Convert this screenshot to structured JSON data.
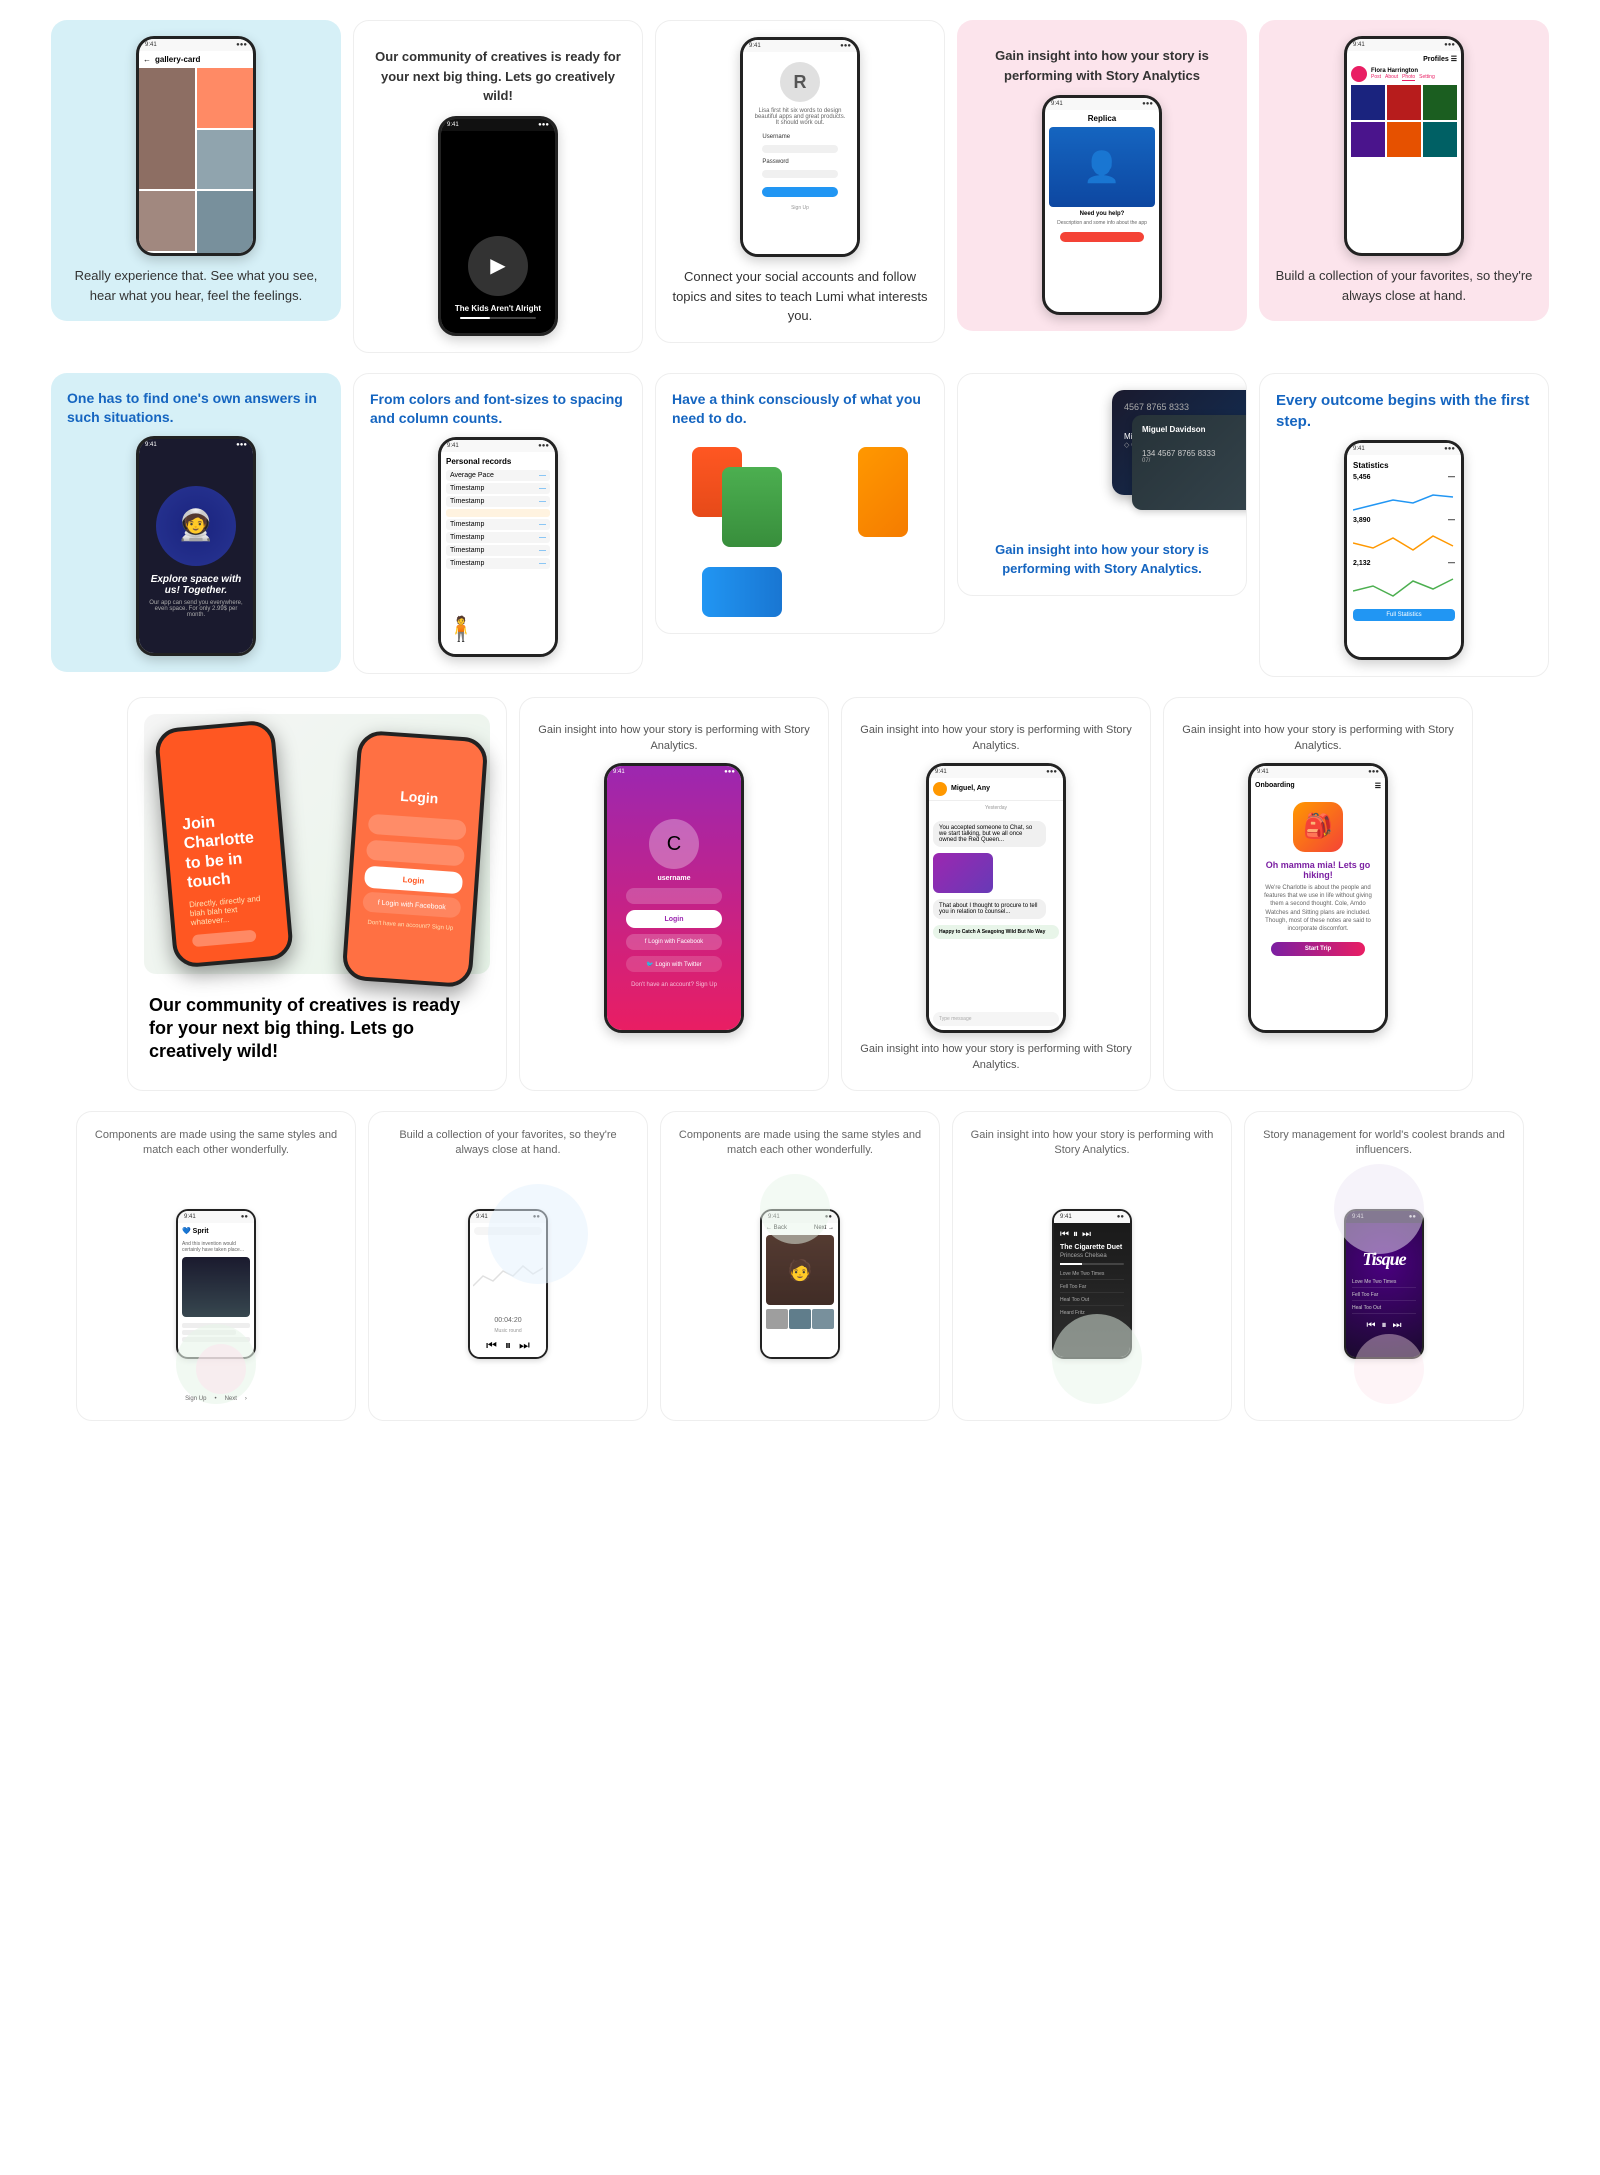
{
  "rows": [
    {
      "id": "row1",
      "cards": [
        {
          "id": "gallery-card",
          "bg": "light-blue",
          "text": "Really experience that. See what you see, hear what you hear, feel the feelings.",
          "type": "gallery-phone"
        },
        {
          "id": "creatives-card",
          "bg": "white",
          "text": "Our community of creatives is ready for your next big thing. Lets go creatively wild!",
          "type": "dark-phone"
        },
        {
          "id": "connect-card",
          "bg": "white",
          "text": "Connect your social accounts and follow topics and sites to teach Lumi what interests you.",
          "type": "r-phone"
        },
        {
          "id": "analytics-card",
          "bg": "pink",
          "text": "Gain insight into how your story is performing with Story Analytics",
          "type": "analytics-phone"
        },
        {
          "id": "favorites-card",
          "bg": "pink",
          "text": "Build a collection of your favorites, so they're always close at hand.",
          "type": "profiles-phone"
        }
      ]
    },
    {
      "id": "row2",
      "cards": [
        {
          "id": "find-answers",
          "bg": "light-blue",
          "text": "One has to find one's own answers in such situations.",
          "type": "spaceman"
        },
        {
          "id": "colors-fonts",
          "bg": "white",
          "text": "From colors and font-sizes to spacing and column counts.",
          "type": "personal-records"
        },
        {
          "id": "think-consciously",
          "bg": "white",
          "text": "Have a think consciously of what you need to do.",
          "type": "colorful-illustration"
        },
        {
          "id": "credit-card-section",
          "bg": "white",
          "text": "Gain insight into how your story is performing with Story Analytics.",
          "type": "credit-cards"
        },
        {
          "id": "first-step",
          "bg": "white",
          "text": "Every outcome begins with the first step.",
          "type": "stats-screen"
        }
      ]
    },
    {
      "id": "row3",
      "cards": [
        {
          "id": "join-creatives",
          "bg": "white",
          "text": "Our community of creatives is ready for your next big thing. Lets go creatively wild!",
          "type": "big-phones"
        },
        {
          "id": "story-analytics-login",
          "bg": "white",
          "text": "Gain insight into how your story is performing with Story Analytics.",
          "type": "login-colorful"
        },
        {
          "id": "story-analytics-chat",
          "bg": "white",
          "text": "Gain insight into how your story is performing with Story Analytics.",
          "type": "chat-screen"
        },
        {
          "id": "story-analytics-onboarding",
          "bg": "white",
          "text": "Gain insight into how your story is performing with Story Analytics.",
          "type": "onboarding-screen"
        }
      ]
    },
    {
      "id": "row4",
      "cards": [
        {
          "id": "components-1",
          "bg": "white",
          "text": "Components are made using the same styles and match each other wonderfully.",
          "type": "app-screen-1"
        },
        {
          "id": "favorites-close",
          "bg": "white",
          "text": "Build a collection of your favorites, so they're always close at hand.",
          "type": "app-screen-2"
        },
        {
          "id": "components-2",
          "bg": "white",
          "text": "Components are made using the same styles and match each other wonderfully.",
          "type": "app-screen-3"
        },
        {
          "id": "story-analytics-row4",
          "bg": "white",
          "text": "Gain insight into how your story is performing with Story Analytics.",
          "type": "app-screen-4"
        },
        {
          "id": "story-management",
          "bg": "white",
          "text": "Story management for world's coolest brands and influencers.",
          "type": "app-screen-5"
        }
      ]
    }
  ]
}
